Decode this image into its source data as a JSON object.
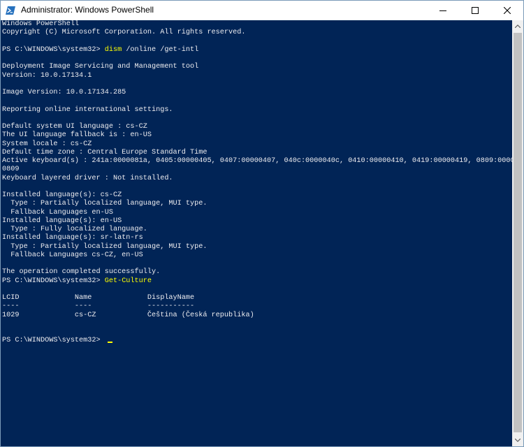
{
  "window": {
    "title": "Administrator: Windows PowerShell"
  },
  "colors": {
    "console_bg": "#012456",
    "console_text": "#eeedf0",
    "command_text": "#ffff00"
  },
  "console": {
    "lines": [
      {
        "text": "Windows PowerShell"
      },
      {
        "text": "Copyright (C) Microsoft Corporation. All rights reserved."
      },
      {
        "text": ""
      },
      {
        "prompt": "PS C:\\WINDOWS\\system32> ",
        "command": "dism",
        "args": " /online /get-intl"
      },
      {
        "text": ""
      },
      {
        "text": "Deployment Image Servicing and Management tool"
      },
      {
        "text": "Version: 10.0.17134.1"
      },
      {
        "text": ""
      },
      {
        "text": "Image Version: 10.0.17134.285"
      },
      {
        "text": ""
      },
      {
        "text": "Reporting online international settings."
      },
      {
        "text": ""
      },
      {
        "text": "Default system UI language : cs-CZ"
      },
      {
        "text": "The UI language fallback is : en-US"
      },
      {
        "text": "System locale : cs-CZ"
      },
      {
        "text": "Default time zone : Central Europe Standard Time"
      },
      {
        "text": "Active keyboard(s) : 241a:0000081a, 0405:00000405, 0407:00000407, 040c:0000040c, 0410:00000410, 0419:00000419, 0809:0000"
      },
      {
        "text": "0809"
      },
      {
        "text": "Keyboard layered driver : Not installed."
      },
      {
        "text": ""
      },
      {
        "text": "Installed language(s): cs-CZ"
      },
      {
        "text": "  Type : Partially localized language, MUI type."
      },
      {
        "text": "  Fallback Languages en-US"
      },
      {
        "text": "Installed language(s): en-US"
      },
      {
        "text": "  Type : Fully localized language."
      },
      {
        "text": "Installed language(s): sr-latn-rs"
      },
      {
        "text": "  Type : Partially localized language, MUI type."
      },
      {
        "text": "  Fallback Languages cs-CZ, en-US"
      },
      {
        "text": ""
      },
      {
        "text": "The operation completed successfully."
      },
      {
        "prompt": "PS C:\\WINDOWS\\system32> ",
        "command": "Get-Culture",
        "args": ""
      },
      {
        "text": ""
      },
      {
        "text": "LCID             Name             DisplayName"
      },
      {
        "text": "----             ----             -----------"
      },
      {
        "text": "1029             cs-CZ            Čeština (Česká republika)"
      },
      {
        "text": ""
      },
      {
        "text": ""
      },
      {
        "prompt": "PS C:\\WINDOWS\\system32> ",
        "command": "",
        "args": "",
        "cursor": true
      }
    ]
  }
}
